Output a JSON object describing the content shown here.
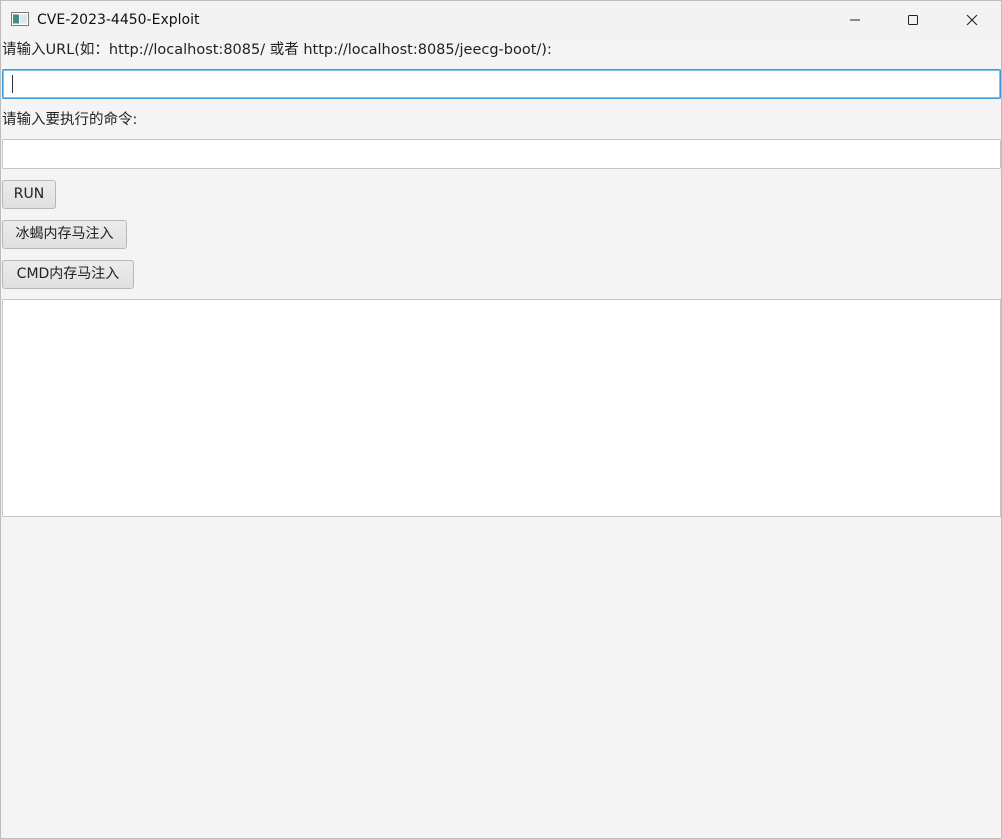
{
  "window": {
    "title": "CVE-2023-4450-Exploit",
    "icon": "app-window-icon",
    "controls": {
      "minimize_icon": "minimize-icon",
      "maximize_icon": "maximize-icon",
      "close_icon": "close-icon"
    }
  },
  "form": {
    "url_label": "请输入URL(如：http://localhost:8085/ 或者 http://localhost:8085/jeecg-boot/):",
    "url_value": "",
    "cmd_label": "请输入要执行的命令:",
    "cmd_value": ""
  },
  "buttons": {
    "run": "RUN",
    "behinder_inject": "冰蝎内存马注入",
    "cmd_inject": "CMD内存马注入"
  },
  "output": {
    "text": ""
  },
  "colors": {
    "background": "#f4f4f4",
    "focus_border": "#3c9ad8",
    "field_background": "#ffffff"
  }
}
